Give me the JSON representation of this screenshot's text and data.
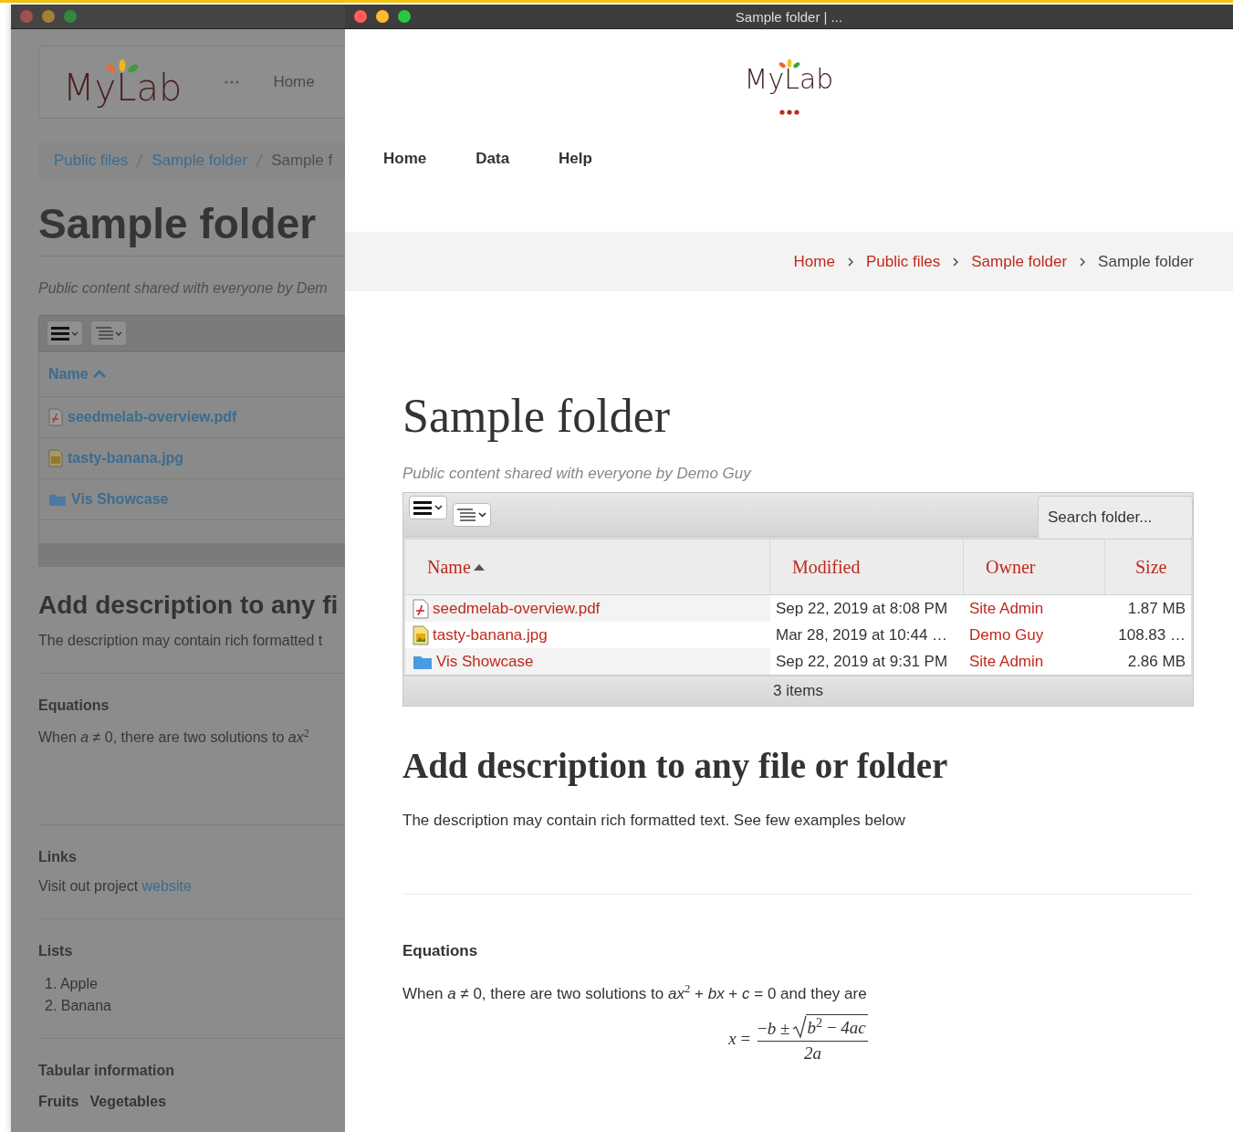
{
  "back_window": {
    "active": false,
    "logo": "MyLab",
    "nav": [
      {
        "label": "Home"
      }
    ],
    "breadcrumb": [
      {
        "label": "Public files",
        "link": true
      },
      {
        "label": "Sample folder",
        "link": true
      },
      {
        "label": "Sample f",
        "link": false
      }
    ],
    "heading": "Sample folder",
    "subtitle": "Public content shared with everyone by Dem",
    "table": {
      "columns": [
        {
          "label": "Name",
          "sorted": true
        }
      ],
      "rows": [
        {
          "name": "seedmelab-overview.pdf",
          "kind": "pdf"
        },
        {
          "name": "tasty-banana.jpg",
          "kind": "image"
        },
        {
          "name": "Vis Showcase",
          "kind": "folder"
        }
      ]
    },
    "description": {
      "heading": "Add description to any fi",
      "text": "The description may contain rich formatted t"
    },
    "equations": {
      "heading": "Equations",
      "text": "When *a* ≠ 0, there are two solutions to *ax*$^{2}$"
    },
    "links": {
      "heading": "Links",
      "text": "Visit out project ",
      "link": "website"
    },
    "lists": {
      "heading": "Lists",
      "items": [
        "1. Apple",
        "2. Banana"
      ]
    },
    "tabular": {
      "heading": "Tabular information",
      "columns": [
        "Fruits",
        "Vegetables"
      ]
    }
  },
  "front_window": {
    "active": true,
    "title": "Sample folder | ...",
    "logo": "MyLab",
    "nav": [
      {
        "label": "Home"
      },
      {
        "label": "Data"
      },
      {
        "label": "Help"
      }
    ],
    "breadcrumb": [
      {
        "label": "Home",
        "link": true
      },
      {
        "label": "Public files",
        "link": true
      },
      {
        "label": "Sample folder",
        "link": true
      },
      {
        "label": "Sample folder",
        "link": false
      }
    ],
    "heading": "Sample folder",
    "subtitle": "Public content shared with everyone by Demo Guy",
    "search": {
      "placeholder": "Search folder..."
    },
    "table": {
      "columns": [
        {
          "label": "Name",
          "sorted": true
        },
        {
          "label": "Modified",
          "sorted": false
        },
        {
          "label": "Owner",
          "sorted": false
        },
        {
          "label": "Size",
          "sorted": false
        }
      ],
      "rows": [
        {
          "name": "seedmelab-overview.pdf",
          "kind": "pdf",
          "modified": "Sep 22, 2019 at 8:08 PM",
          "owner": "Site Admin",
          "size": "1.87 MB"
        },
        {
          "name": "tasty-banana.jpg",
          "kind": "image",
          "modified": "Mar 28, 2019 at 10:44 …",
          "owner": "Demo Guy",
          "size": "108.83 …"
        },
        {
          "name": "Vis Showcase",
          "kind": "folder",
          "modified": "Sep 22, 2019 at 9:31 PM",
          "owner": "Site Admin",
          "size": "2.86 MB"
        }
      ],
      "footer": "3 items"
    },
    "description": {
      "heading": "Add description to any file or folder",
      "text": "The description may contain rich formatted text. See few examples below"
    },
    "equations": {
      "heading": "Equations",
      "text": "When *a* ≠ 0, there are two solutions to *ax*$^{2}$ + *bx* + *c* = 0 and they are",
      "formula": {
        "lhs": "*x* =",
        "numerator": "−*b* ±",
        "radicand": "*b*$^{2}$ − *4ac*",
        "denominator": "*2a*"
      }
    }
  }
}
